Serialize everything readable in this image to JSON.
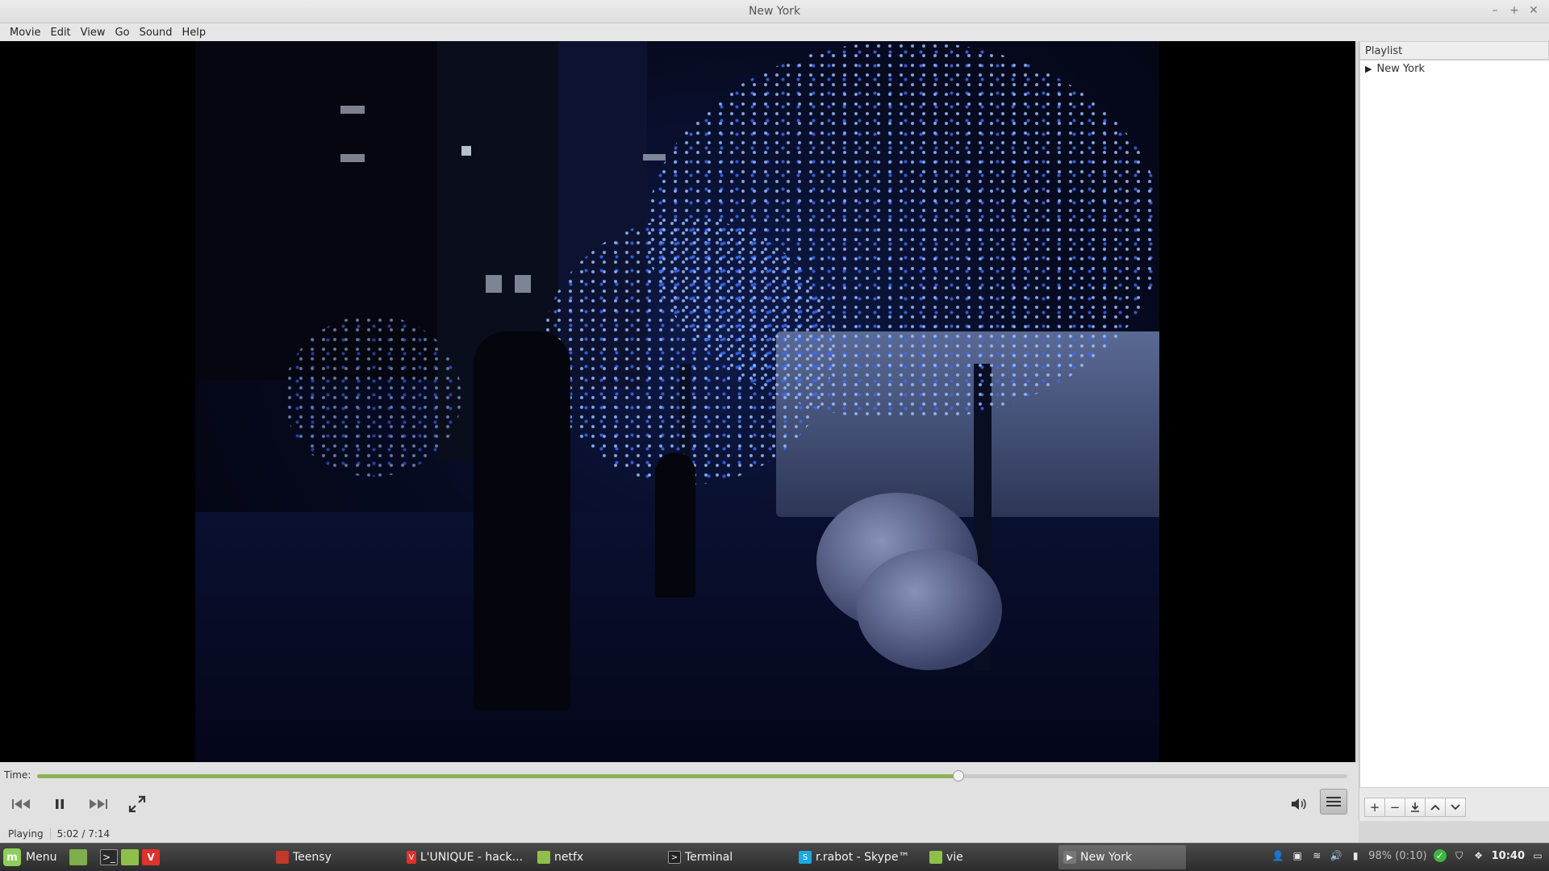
{
  "window": {
    "title": "New York"
  },
  "menubar": {
    "items": [
      "Movie",
      "Edit",
      "View",
      "Go",
      "Sound",
      "Help"
    ]
  },
  "playlist": {
    "header": "Playlist",
    "items": [
      {
        "label": "New York",
        "icon": "play-triangle-icon"
      }
    ],
    "tools": [
      "add-icon",
      "remove-icon",
      "save-icon",
      "move-up-icon",
      "move-down-icon"
    ]
  },
  "controls": {
    "time_label": "Time:",
    "progress": 0.703,
    "status": "Playing",
    "time": "5:02 / 7:14",
    "accent": "#8fb255"
  },
  "taskbar": {
    "menu_label": "Menu",
    "tasks": [
      {
        "label": "Teensy",
        "icon": "teensy-app-icon",
        "color": "#c0392b"
      },
      {
        "label": "L'UNIQUE - hack...",
        "icon": "vivaldi-icon",
        "color": "#e0312b"
      },
      {
        "label": "netfx",
        "icon": "folder-icon",
        "color": "#8fbf4a"
      },
      {
        "label": "Terminal",
        "icon": "terminal-icon",
        "color": "#333333"
      },
      {
        "label": "r.rabot - Skype™",
        "icon": "skype-icon",
        "color": "#1ea7e1"
      },
      {
        "label": "vie",
        "icon": "folder-icon",
        "color": "#8fbf4a"
      },
      {
        "label": "New York",
        "icon": "video-player-icon",
        "color": "#777777"
      }
    ],
    "battery": "98% (0:10)",
    "clock": "10:40"
  }
}
